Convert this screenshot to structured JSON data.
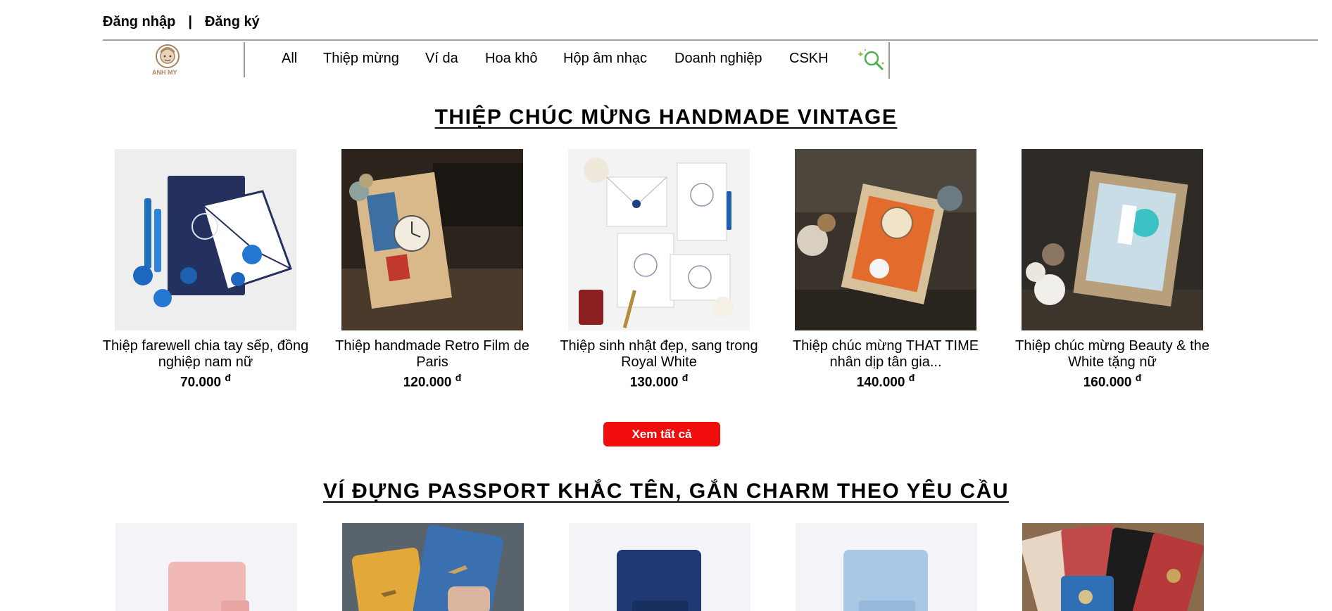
{
  "auth": {
    "login": "Đăng nhập",
    "separator": "|",
    "register": "Đăng ký"
  },
  "brand": {
    "logo_text": "ANH MY"
  },
  "nav": {
    "items": [
      {
        "label": "All"
      },
      {
        "label": "Thiệp mừng"
      },
      {
        "label": "Ví da"
      },
      {
        "label": "Hoa khô"
      },
      {
        "label": "Hộp âm nhạc"
      },
      {
        "label": "Doanh nghiệp"
      },
      {
        "label": "CSKH"
      }
    ],
    "search_icon": "magnifier-sparkle-icon"
  },
  "sections": [
    {
      "title": "THIỆP CHÚC MỪNG HANDMADE VINTAGE",
      "products": [
        {
          "name": "Thiệp farewell chia tay sếp, đồng nghiệp nam nữ",
          "price": "70.000",
          "currency": "đ"
        },
        {
          "name": "Thiệp handmade Retro Film de Paris",
          "price": "120.000",
          "currency": "đ"
        },
        {
          "name": "Thiệp sinh nhật đẹp, sang trong Royal White",
          "price": "130.000",
          "currency": "đ"
        },
        {
          "name": "Thiệp chúc mừng THAT TIME nhân dịp tân gia...",
          "price": "140.000",
          "currency": "đ"
        },
        {
          "name": "Thiệp chúc mừng Beauty & the White tặng nữ",
          "price": "160.000",
          "currency": "đ"
        }
      ],
      "see_all": "Xem tất cả"
    },
    {
      "title": "VÍ ĐỰNG PASSPORT KHẮC TÊN, GẮN CHARM THEO YÊU CẦU"
    }
  ],
  "colors": {
    "accent_red": "#f20d0d",
    "divider": "#a0a0a0",
    "logo_brown": "#a9855f",
    "search_green": "#4caf50"
  }
}
